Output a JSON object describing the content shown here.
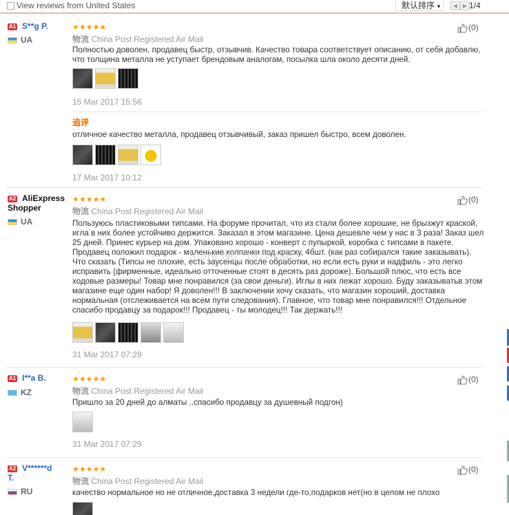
{
  "toolbar": {
    "filter_label": "View reviews from United States",
    "sort_label": "默认排序",
    "page_indicator": "1/4"
  },
  "reviews": [
    {
      "badge": "A1",
      "user": "S**g P.",
      "country": "UA",
      "ship_label": "物流",
      "ship_value": "China Post Registered Air Mail",
      "likes": "(0)",
      "text": "Полностью доволен, продавец быстр, отзывчив. Качество товара соответствует описанию, от себя добавлю, что толщина металла не уступает брендовым аналогам, посылка шла около десяти дней.",
      "date": "15 Mar 2017 15:56",
      "followup_tag": "追评",
      "followup_text": "отличное качество металла, продавец отзывчивый, заказ пришел быстро, всем доволен.",
      "followup_date": "17 Mar 2017 10:12"
    },
    {
      "badge": "A2",
      "user_line1": "AliExpress",
      "user_line2": "Shopper",
      "country": "UA",
      "ship_label": "物流",
      "ship_value": "China Post Registered Air Mail",
      "likes": "(0)",
      "text": "Пользуюсь пластиковыми типсами. На форуме прочитал, что из стали более хорошие, не брызжут краской, игла в них более устойчиво держится. Заказал в этом магазине. Цена дешевле чем у нас в 3 раза! Заказ шел 25 дней. Принес курьер на дом. Упаковано хорошо - конверт с пупыркой, коробка с типсами в пакете. Продавец положил подарок - маленькие колпачки под краску, 4бшт. (как раз собирался такие заказывать). Что сказать (Типсы не плохие, есть заусенцы после обработки, но если есть руки и надфиль - это легко исправить (фирменные, идеально отточенные стоят в десять раз дороже). Большой плюс, что есть все ходовые размеры! Товар мне понравился (за свои деньги). Иглы в них лежат хорошо. Буду заказыватьв этом магазине еще один набор! Я доволен!!! В заключении хочу сказать, что магазин хороший, доставка нормальная (отслеживается на всем пути следования). Главное, что товар мне понравился!!! Отдельное спасибо продавцу за подарок!!! Продавец - ты молодец!!! Так держать!!!",
      "date": "31 Mar 2017 07:29",
      "watermark": "Store No: 1428438"
    },
    {
      "badge": "A1",
      "user": "I**a B.",
      "country": "KZ",
      "ship_label": "物流",
      "ship_value": "China Post Registered Air Mail",
      "likes": "(0)",
      "text": "Пришло за 20 дней до алматы ..спасибо продавцу за душевный подгон)",
      "date": "31 Mar 2017 07:29"
    },
    {
      "badge": "A2",
      "user_line1": "V******d",
      "user_line2": "T.",
      "country": "RU",
      "ship_label": "物流",
      "ship_value": "China Post Registered Air Mail",
      "likes": "(0)",
      "text": "качество нормальное но не отличное,доставка 3 недели где-то,подарков нет(но в целом не плохо"
    }
  ],
  "colors": {
    "stars": "#f39a1a",
    "username": "#2a6ab8",
    "badge": "#dd3333",
    "followup": "#e26a00"
  }
}
